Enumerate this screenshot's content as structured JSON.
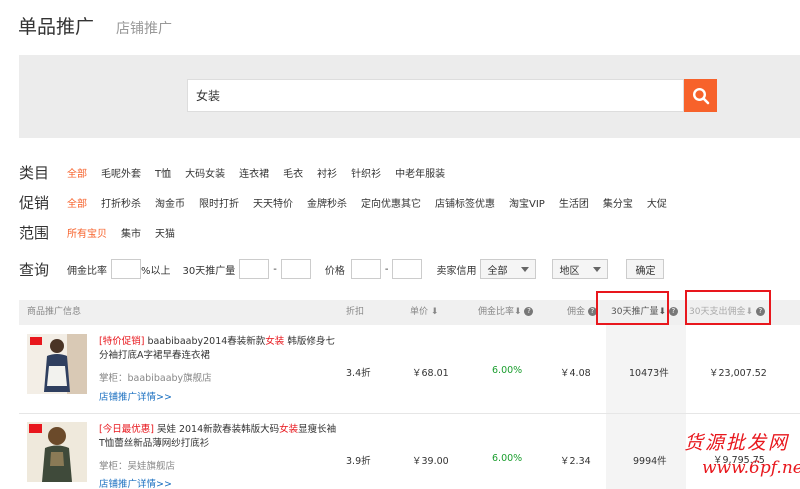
{
  "tabs": {
    "active": "单品推广",
    "other": "店铺推广"
  },
  "search": {
    "value": "女装"
  },
  "filters": {
    "category": {
      "label": "类目",
      "items": [
        "全部",
        "毛呢外套",
        "T恤",
        "大码女装",
        "连衣裙",
        "毛衣",
        "衬衫",
        "针织衫",
        "中老年服装"
      ]
    },
    "promotion": {
      "label": "促销",
      "items": [
        "全部",
        "打折秒杀",
        "淘金币",
        "限时打折",
        "天天特价",
        "金牌秒杀",
        "定向优惠其它",
        "店铺标签优惠",
        "淘宝VIP",
        "生活团",
        "集分宝",
        "大促"
      ]
    },
    "scope": {
      "label": "范围",
      "items": [
        "所有宝贝",
        "集市",
        "天猫"
      ]
    }
  },
  "query": {
    "label": "查询",
    "commission_label": "佣金比率",
    "commission_suffix": "%以上",
    "volume_label": "30天推广量",
    "dash": "-",
    "price_label": "价格",
    "credit_label": "卖家信用",
    "credit_value": "全部",
    "region_value": "地区",
    "confirm": "确定"
  },
  "table": {
    "headers": {
      "info": "商品推广信息",
      "discount": "折扣",
      "price": "单价",
      "rate": "佣金比率",
      "commission": "佣金",
      "volume": "30天推广量",
      "spend": "30天支出佣金"
    },
    "rows": [
      {
        "promo": "[特价促销]",
        "title_a": " baabibaaby2014春装新款",
        "keyword": "女装",
        "title_b": " 韩版修身七分袖打底A字裙早春连衣裙",
        "shop": "掌柜：baabibaaby旗舰店",
        "link": "店铺推广详情>>",
        "discount": "3.4折",
        "price": "￥68.01",
        "rate": "6.00%",
        "commission": "￥4.08",
        "volume": "10473件",
        "spend": "￥23,007.52"
      },
      {
        "promo": "[今日最优惠]",
        "title_a": " 吴娃 2014新款春装韩版大码",
        "keyword": "女装",
        "title_b": "显瘦长袖T恤蕾丝新品薄网纱打底衫",
        "shop": "掌柜：吴娃旗舰店",
        "link": "店铺推广详情>>",
        "discount": "3.9折",
        "price": "￥39.00",
        "rate": "6.00%",
        "commission": "￥2.34",
        "volume": "9994件",
        "spend": "￥9,795.75"
      }
    ]
  },
  "watermark": {
    "line1": "货源批发网",
    "line2": "www.6pf.net"
  },
  "colors": {
    "accent": "#f7622b",
    "highlight_box": "#e8171d",
    "rate_green": "#1b9e2e",
    "link_blue": "#1a6fc0"
  }
}
